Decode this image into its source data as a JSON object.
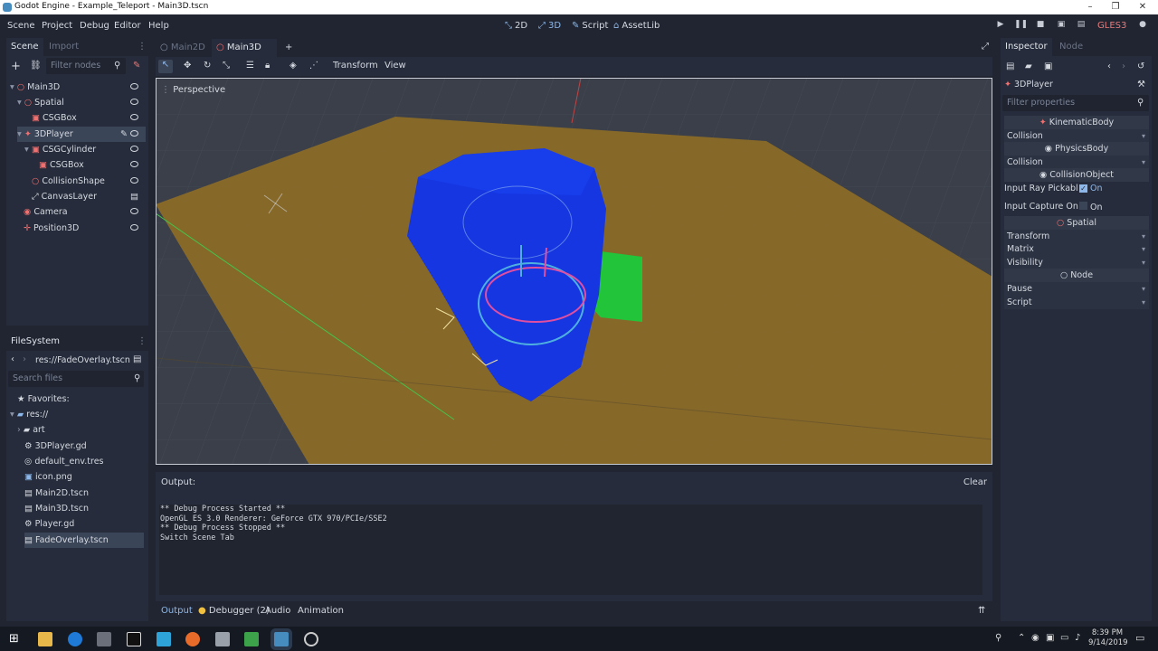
{
  "window": {
    "title": "Godot Engine - Example_Teleport - Main3D.tscn",
    "min": "–",
    "max": "❐",
    "close": "✕"
  },
  "menu": {
    "scene": "Scene",
    "project": "Project",
    "debug": "Debug",
    "editor": "Editor",
    "help": "Help"
  },
  "workspaces": {
    "2d": "2D",
    "3d": "3D",
    "script": "Script",
    "assetlib": "AssetLib"
  },
  "renderer": "GLES3",
  "scene_dock": {
    "tabs": {
      "scene": "Scene",
      "import": "Import"
    },
    "filter_placeholder": "Filter nodes",
    "nodes": [
      {
        "label": "Main3D"
      },
      {
        "label": "Spatial"
      },
      {
        "label": "CSGBox"
      },
      {
        "label": "3DPlayer"
      },
      {
        "label": "CSGCylinder"
      },
      {
        "label": "CSGBox"
      },
      {
        "label": "CollisionShape"
      },
      {
        "label": "CanvasLayer"
      },
      {
        "label": "Camera"
      },
      {
        "label": "Position3D"
      }
    ]
  },
  "filesystem": {
    "title": "FileSystem",
    "path": "res://FadeOverlay.tscn",
    "search_placeholder": "Search files",
    "items": [
      {
        "label": "Favorites:"
      },
      {
        "label": "res://"
      },
      {
        "label": "art"
      },
      {
        "label": "3DPlayer.gd"
      },
      {
        "label": "default_env.tres"
      },
      {
        "label": "icon.png"
      },
      {
        "label": "Main2D.tscn"
      },
      {
        "label": "Main3D.tscn"
      },
      {
        "label": "Player.gd"
      },
      {
        "label": "FadeOverlay.tscn"
      }
    ]
  },
  "editor_tabs": {
    "tab1": "Main2D",
    "tab2": "Main3D",
    "add": "+"
  },
  "viewport_toolbar": {
    "transform": "Transform",
    "view": "View"
  },
  "viewport": {
    "label": "Perspective"
  },
  "output": {
    "title": "Output:",
    "clear": "Clear",
    "lines": [
      "** Debug Process Started **",
      "OpenGL ES 3.0 Renderer: GeForce GTX 970/PCIe/SSE2",
      "** Debug Process Stopped **",
      "Switch Scene Tab"
    ]
  },
  "bottom_tabs": {
    "output": "Output",
    "debugger": "Debugger (2)",
    "audio": "Audio",
    "animation": "Animation"
  },
  "inspector": {
    "tabs": {
      "inspector": "Inspector",
      "node": "Node"
    },
    "node_name": "3DPlayer",
    "filter_placeholder": "Filter properties",
    "kinematic": "KinematicBody",
    "collision1": "Collision",
    "physics": "PhysicsBody",
    "collision2": "Collision",
    "collision_object": "CollisionObject",
    "ray_label": "Input Ray Pickabl",
    "ray_value": "On",
    "capture_label": "Input Capture On",
    "capture_value": "On",
    "spatial": "Spatial",
    "transform": "Transform",
    "matrix": "Matrix",
    "visibility": "Visibility",
    "node": "Node",
    "pause": "Pause",
    "script": "Script"
  },
  "clock": {
    "time": "8:39 PM",
    "date": "9/14/2019"
  },
  "colors": {
    "accent": "#478cbf",
    "panel": "#262c3b",
    "background": "#202531",
    "ground": "#8a6a28",
    "cylinder": "#1536e0",
    "box": "#22c43a"
  }
}
